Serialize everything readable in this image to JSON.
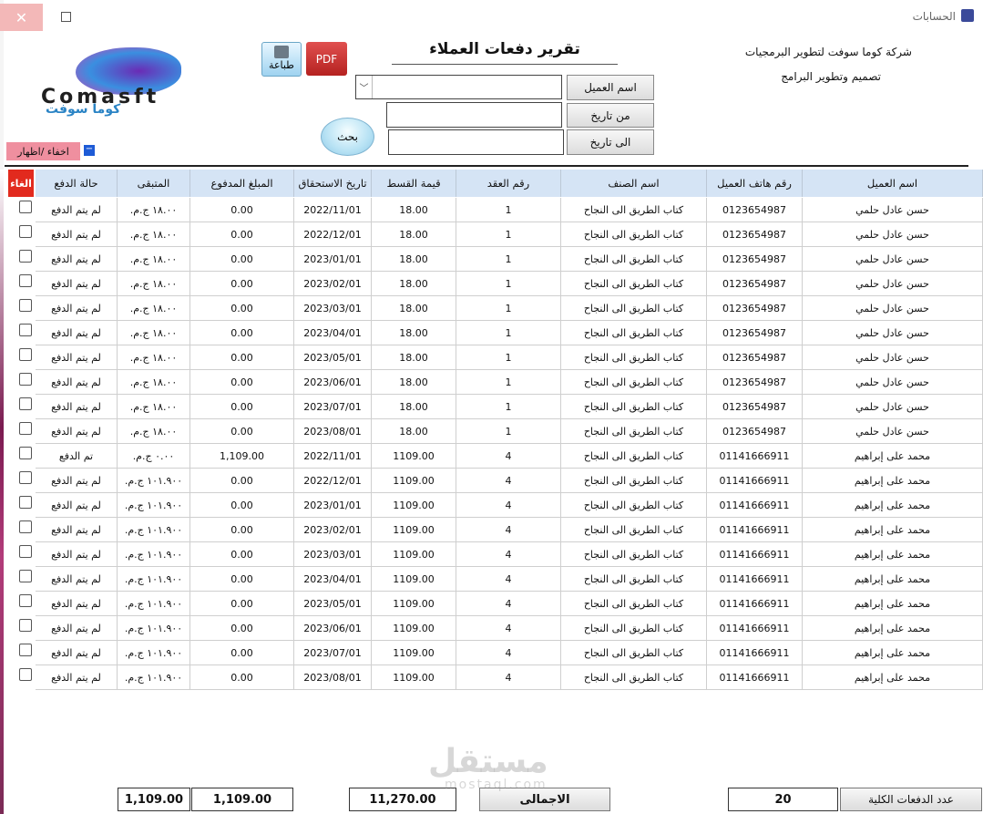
{
  "window": {
    "title": "الحسابات",
    "close_glyph": "✕"
  },
  "company": {
    "name": "شركة كوما سوفت لتطوير البرمجيات",
    "tagline": "تصميم وتطوير البرامج"
  },
  "logo": {
    "text_en": "Comasft",
    "text_ar": "كوما سوفت"
  },
  "report_title": "تقرير دفعات العملاء",
  "toolbar": {
    "print_label": "طباعة",
    "pdf_label": "PDF"
  },
  "filters": {
    "customer_label": "اسم العميل",
    "from_date_label": "من تاريخ",
    "to_date_label": "الى  تاريخ",
    "customer_value": "",
    "from_date_value": "",
    "to_date_value": "",
    "search_label": "بحث"
  },
  "toggle": {
    "label": "اخفاء /اظهار",
    "glyph": "−"
  },
  "table": {
    "headers": {
      "customer": "اسم العميل",
      "phone": "رقم هاتف العميل",
      "item": "اسم الصنف",
      "contract": "رقم العقد",
      "installment": "قيمة القسط",
      "due_date": "تاريخ الاستحقاق",
      "paid": "المبلغ المدفوع",
      "remaining": "المتبقى",
      "status": "حالة الدفع",
      "cancel": "الغاء"
    },
    "rows": [
      {
        "customer": "حسن عادل حلمي",
        "phone": "0123654987",
        "item": "كتاب الطريق الى النجاح",
        "contract": "1",
        "installment": "18.00",
        "due_date": "2022/11/01",
        "paid": "0.00",
        "remaining": "١٨.٠٠ ج.م.",
        "status": "لم يتم الدفع"
      },
      {
        "customer": "حسن عادل حلمي",
        "phone": "0123654987",
        "item": "كتاب الطريق الى النجاح",
        "contract": "1",
        "installment": "18.00",
        "due_date": "2022/12/01",
        "paid": "0.00",
        "remaining": "١٨.٠٠ ج.م.",
        "status": "لم يتم الدفع"
      },
      {
        "customer": "حسن عادل حلمي",
        "phone": "0123654987",
        "item": "كتاب الطريق الى النجاح",
        "contract": "1",
        "installment": "18.00",
        "due_date": "2023/01/01",
        "paid": "0.00",
        "remaining": "١٨.٠٠ ج.م.",
        "status": "لم يتم الدفع"
      },
      {
        "customer": "حسن عادل حلمي",
        "phone": "0123654987",
        "item": "كتاب الطريق الى النجاح",
        "contract": "1",
        "installment": "18.00",
        "due_date": "2023/02/01",
        "paid": "0.00",
        "remaining": "١٨.٠٠ ج.م.",
        "status": "لم يتم الدفع"
      },
      {
        "customer": "حسن عادل حلمي",
        "phone": "0123654987",
        "item": "كتاب الطريق الى النجاح",
        "contract": "1",
        "installment": "18.00",
        "due_date": "2023/03/01",
        "paid": "0.00",
        "remaining": "١٨.٠٠ ج.م.",
        "status": "لم يتم الدفع"
      },
      {
        "customer": "حسن عادل حلمي",
        "phone": "0123654987",
        "item": "كتاب الطريق الى النجاح",
        "contract": "1",
        "installment": "18.00",
        "due_date": "2023/04/01",
        "paid": "0.00",
        "remaining": "١٨.٠٠ ج.م.",
        "status": "لم يتم الدفع"
      },
      {
        "customer": "حسن عادل حلمي",
        "phone": "0123654987",
        "item": "كتاب الطريق الى النجاح",
        "contract": "1",
        "installment": "18.00",
        "due_date": "2023/05/01",
        "paid": "0.00",
        "remaining": "١٨.٠٠ ج.م.",
        "status": "لم يتم الدفع"
      },
      {
        "customer": "حسن عادل حلمي",
        "phone": "0123654987",
        "item": "كتاب الطريق الى النجاح",
        "contract": "1",
        "installment": "18.00",
        "due_date": "2023/06/01",
        "paid": "0.00",
        "remaining": "١٨.٠٠ ج.م.",
        "status": "لم يتم الدفع"
      },
      {
        "customer": "حسن عادل حلمي",
        "phone": "0123654987",
        "item": "كتاب الطريق الى النجاح",
        "contract": "1",
        "installment": "18.00",
        "due_date": "2023/07/01",
        "paid": "0.00",
        "remaining": "١٨.٠٠ ج.م.",
        "status": "لم يتم الدفع"
      },
      {
        "customer": "حسن عادل حلمي",
        "phone": "0123654987",
        "item": "كتاب الطريق الى النجاح",
        "contract": "1",
        "installment": "18.00",
        "due_date": "2023/08/01",
        "paid": "0.00",
        "remaining": "١٨.٠٠ ج.م.",
        "status": "لم يتم الدفع"
      },
      {
        "customer": "محمد على إبراهيم",
        "phone": "01141666911",
        "item": "كتاب الطريق الى النجاح",
        "contract": "4",
        "installment": "1109.00",
        "due_date": "2022/11/01",
        "paid": "1,109.00",
        "remaining": "٠.٠٠ ج.م.",
        "status": "تم الدفع"
      },
      {
        "customer": "محمد على إبراهيم",
        "phone": "01141666911",
        "item": "كتاب الطريق الى النجاح",
        "contract": "4",
        "installment": "1109.00",
        "due_date": "2022/12/01",
        "paid": "0.00",
        "remaining": "١٠١.٩٠٠ ج.م.",
        "status": "لم يتم الدفع"
      },
      {
        "customer": "محمد على إبراهيم",
        "phone": "01141666911",
        "item": "كتاب الطريق الى النجاح",
        "contract": "4",
        "installment": "1109.00",
        "due_date": "2023/01/01",
        "paid": "0.00",
        "remaining": "١٠١.٩٠٠ ج.م.",
        "status": "لم يتم الدفع"
      },
      {
        "customer": "محمد على إبراهيم",
        "phone": "01141666911",
        "item": "كتاب الطريق الى النجاح",
        "contract": "4",
        "installment": "1109.00",
        "due_date": "2023/02/01",
        "paid": "0.00",
        "remaining": "١٠١.٩٠٠ ج.م.",
        "status": "لم يتم الدفع"
      },
      {
        "customer": "محمد على إبراهيم",
        "phone": "01141666911",
        "item": "كتاب الطريق الى النجاح",
        "contract": "4",
        "installment": "1109.00",
        "due_date": "2023/03/01",
        "paid": "0.00",
        "remaining": "١٠١.٩٠٠ ج.م.",
        "status": "لم يتم الدفع"
      },
      {
        "customer": "محمد على إبراهيم",
        "phone": "01141666911",
        "item": "كتاب الطريق الى النجاح",
        "contract": "4",
        "installment": "1109.00",
        "due_date": "2023/04/01",
        "paid": "0.00",
        "remaining": "١٠١.٩٠٠ ج.م.",
        "status": "لم يتم الدفع"
      },
      {
        "customer": "محمد على إبراهيم",
        "phone": "01141666911",
        "item": "كتاب الطريق الى النجاح",
        "contract": "4",
        "installment": "1109.00",
        "due_date": "2023/05/01",
        "paid": "0.00",
        "remaining": "١٠١.٩٠٠ ج.م.",
        "status": "لم يتم الدفع"
      },
      {
        "customer": "محمد على إبراهيم",
        "phone": "01141666911",
        "item": "كتاب الطريق الى النجاح",
        "contract": "4",
        "installment": "1109.00",
        "due_date": "2023/06/01",
        "paid": "0.00",
        "remaining": "١٠١.٩٠٠ ج.م.",
        "status": "لم يتم الدفع"
      },
      {
        "customer": "محمد على إبراهيم",
        "phone": "01141666911",
        "item": "كتاب الطريق الى النجاح",
        "contract": "4",
        "installment": "1109.00",
        "due_date": "2023/07/01",
        "paid": "0.00",
        "remaining": "١٠١.٩٠٠ ج.م.",
        "status": "لم يتم الدفع"
      },
      {
        "customer": "محمد على إبراهيم",
        "phone": "01141666911",
        "item": "كتاب الطريق الى النجاح",
        "contract": "4",
        "installment": "1109.00",
        "due_date": "2023/08/01",
        "paid": "0.00",
        "remaining": "١٠١.٩٠٠ ج.م.",
        "status": "لم يتم الدفع"
      }
    ]
  },
  "footer": {
    "count_label": "عدد الدفعات الكلية",
    "count_value": "20",
    "total_label": "الاجمالى",
    "total_installments": "11,270.00",
    "total_paid": "1,109.00",
    "total_remaining": "1,109.00"
  },
  "watermark": {
    "ar": "مستقل",
    "en": "mostaql.com"
  },
  "colors": {
    "header_bg": "#d5e4f5",
    "cancel_header": "#e22a1e",
    "toggle_bg": "#ef8f9f",
    "pdf_button": "#c9302c"
  }
}
